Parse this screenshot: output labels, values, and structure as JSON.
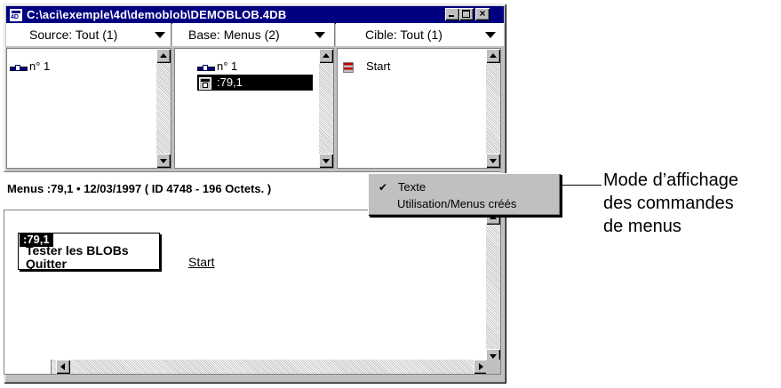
{
  "window": {
    "title": "C:\\aci\\exemple\\4d\\demoblob\\DEMOBLOB.4DB",
    "minimize_label": "_",
    "close_label": "×"
  },
  "columns": [
    {
      "header": "Source: Tout (1)",
      "items": [
        {
          "label": "n° 1",
          "icon": "link-icon"
        }
      ]
    },
    {
      "header": "Base: Menus (2)",
      "items": [
        {
          "label": "n° 1",
          "icon": "link-icon"
        },
        {
          "label": ":79,1",
          "icon": "menu-icon",
          "selected": true
        }
      ]
    },
    {
      "header": "Cible: Tout (1)",
      "items": [
        {
          "label": "Start",
          "icon": "start-icon"
        }
      ]
    }
  ],
  "info_bar": {
    "text": "Menus :79,1  •  12/03/1997 ( ID 4748 - 196 Octets. )"
  },
  "display_mode_menu": {
    "items": [
      {
        "label": "Texte",
        "checked": true
      },
      {
        "label": "Utilisation/Menus créés",
        "checked": false
      }
    ],
    "check_glyph": "✔"
  },
  "menu_preview": {
    "title": ":79,1",
    "items": [
      "Tester les BLOBs",
      "Quitter"
    ],
    "linked_label": "Start"
  },
  "annotation": {
    "line1": "Mode d’affichage",
    "line2": "des commandes",
    "line3": "de menus"
  }
}
